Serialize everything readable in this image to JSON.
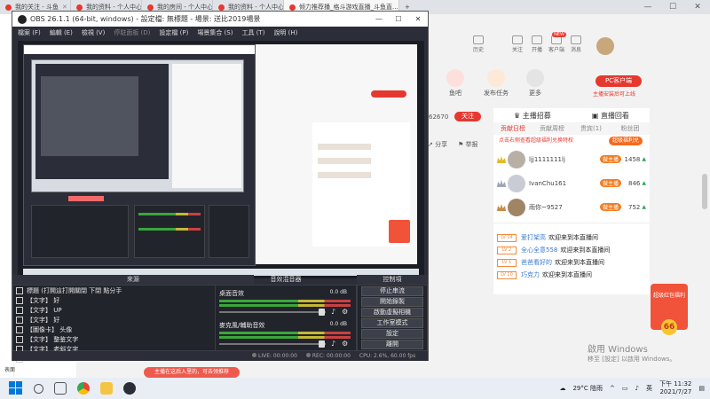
{
  "browser": {
    "tabs": [
      {
        "label": "我的关注 - 斗鱼"
      },
      {
        "label": "我的资料 - 个人中心 - 斗鱼"
      },
      {
        "label": "我的房间 - 个人中心 - 斗鱼"
      },
      {
        "label": "我的资料 - 个人中心 - 斗鱼"
      },
      {
        "label": "倾力推荐播_格斗游戏直播_斗鱼直..."
      }
    ]
  },
  "site": {
    "top_icons": [
      {
        "label": "历史"
      },
      {
        "label": "关注"
      },
      {
        "label": "开播"
      },
      {
        "label": "客户端",
        "badge": "NEW"
      },
      {
        "label": "消息"
      }
    ],
    "features": [
      {
        "label": "鱼吧"
      },
      {
        "label": "发布任务"
      },
      {
        "label": "更多"
      }
    ],
    "pc_button": "PC客户端",
    "pc_sub": "主播安装后可上线",
    "follow_count": "62670",
    "follow_button": "关注",
    "share": "分享",
    "report": "举报",
    "right_panel": {
      "tabs": [
        "主播招募",
        "直播回看"
      ],
      "subtabs": [
        "贡献日榜",
        "贡献周榜",
        "贵宾(1)",
        "粉丝团"
      ],
      "note": "点击右侧查看超级福利兑换特权",
      "note_pill": "超级福利兑",
      "ranks": [
        {
          "name": "ljj1111111lj",
          "tag": "做主播",
          "score": "1458",
          "crown": "#e8b820"
        },
        {
          "name": "IvanChu161",
          "tag": "做主播",
          "score": "846",
          "crown": "#9aa7b5"
        },
        {
          "name": "雨你~9527",
          "tag": "做主播",
          "score": "752",
          "crown": "#c98a4a"
        }
      ],
      "messages": [
        {
          "lv": "LV 14",
          "user": "爱打架高",
          "text": "欢迎来到本直播间"
        },
        {
          "lv": "LV 2",
          "user": "全心全意558",
          "text": "欢迎来到本直播间"
        },
        {
          "lv": "LV 1",
          "user": "爸爸看好的",
          "text": "欢迎来到本直播间"
        },
        {
          "lv": "LV 10",
          "user": "巧克力",
          "text": "欢迎来到本直播间"
        }
      ]
    },
    "gift_box": {
      "text": "超级红包福利",
      "mark": "66"
    },
    "activate_title": "啟用 Windows",
    "activate_sub": "移至 [設定] 以啟用 Windows。",
    "toast": "主播在这后入里的，可去领推荐"
  },
  "obs": {
    "title": "OBS 26.1.1 (64-bit, windows) - 設定檔: 無標題 - 場景: 送比2019場景",
    "menu": [
      {
        "label": "檔案 (F)",
        "dim": false
      },
      {
        "label": "編輯 (E)",
        "dim": false
      },
      {
        "label": "檢視 (V)",
        "dim": false
      },
      {
        "label": "停駐面板 (D)",
        "dim": true
      },
      {
        "label": "設定檔 (P)",
        "dim": false
      },
      {
        "label": "場景集合 (S)",
        "dim": false
      },
      {
        "label": "工具 (T)",
        "dim": false
      },
      {
        "label": "說明 (H)",
        "dim": false
      }
    ],
    "docks": {
      "sources": "來源",
      "mixer": "音效混音器",
      "controls": "控制項"
    },
    "sources": [
      {
        "label": "標題 (打開這打開關閉 下閉 點分手"
      },
      {
        "label": "【文字】 好"
      },
      {
        "label": "【文字】 UP"
      },
      {
        "label": "【文字】 好"
      },
      {
        "label": "【圖像卡】 头像"
      },
      {
        "label": "【文字】 整鉴文字"
      },
      {
        "label": "【文字】 老斜文字"
      },
      {
        "label": "窗口"
      }
    ],
    "mixer": [
      {
        "name": "桌面音效",
        "db": "0.0 dB"
      },
      {
        "name": "麥克風/輔助音效",
        "db": "0.0 dB"
      }
    ],
    "controls": [
      "停止串流",
      "開始錄製",
      "啟動虛擬相機",
      "工作室模式",
      "設定",
      "離開"
    ],
    "status": {
      "live": "LIVE: 00:00:00",
      "rec": "REC: 00:00:00",
      "cpu": "CPU: 2.6%, 60.00 fps"
    }
  },
  "bottom_label": "表面",
  "taskbar": {
    "weather": "29°C 陰雨",
    "ime": "英",
    "time": "下午 11:32",
    "date": "2021/7/27"
  }
}
